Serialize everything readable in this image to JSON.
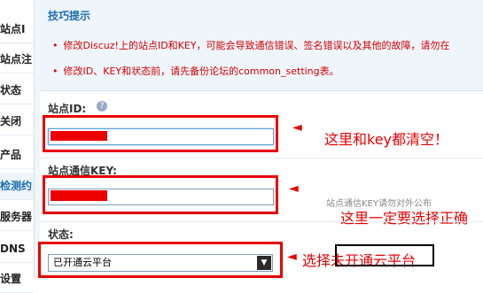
{
  "sidebar": {
    "items": [
      {
        "label": "站点I",
        "active": false
      },
      {
        "label": "站点注",
        "active": false
      },
      {
        "label": "状态",
        "active": false
      },
      {
        "label": "关闭",
        "active": false
      },
      {
        "label": "产品",
        "active": false
      },
      {
        "label": "检测约",
        "active": true
      },
      {
        "label": "服务器",
        "active": false
      },
      {
        "label": "DNS",
        "active": false
      },
      {
        "label": "设置",
        "active": false
      }
    ]
  },
  "tips": {
    "title": "技巧提示",
    "lines": [
      "修改Discuz!上的站点ID和KEY，可能会导致通信错误、签名错误以及其他的故障，请勿在",
      "修改ID、KEY和状态前，请先备份论坛的common_setting表。"
    ]
  },
  "form": {
    "site_id_label": "站点ID:",
    "help_icon": "?",
    "site_key_label": "站点通信KEY:",
    "site_key_hint": "站点通信KEY请勿对外公布",
    "status_label": "状态:",
    "status_selected": "已开通云平台"
  },
  "annotations": {
    "arrow_glyph": "◄",
    "note_clear": "这里和key都清空！",
    "note_select": "这里一定要选择正确",
    "note_choose_prefix": "选择",
    "note_choose_value": "未开通云平台"
  },
  "colors": {
    "accent": "#1a6db0",
    "warning_text": "#d40000",
    "annotation_red": "#e60000"
  }
}
